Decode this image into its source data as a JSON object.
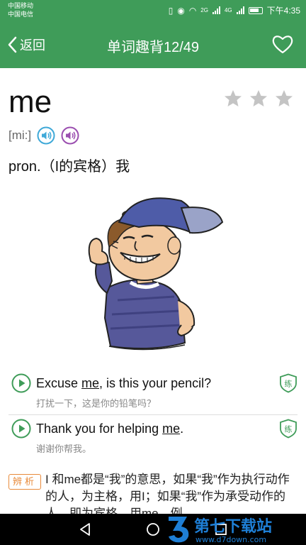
{
  "status_bar": {
    "carrier_1": "中国移动",
    "carrier_2": "中国电信",
    "signal_labels": [
      "2G",
      "4G"
    ],
    "time": "下午4:35"
  },
  "header": {
    "back_label": "返回",
    "title": "单词趣背12/49",
    "favorite_icon": "heart-outline-icon"
  },
  "word": {
    "text": "me",
    "rating": 0,
    "rating_max": 3,
    "phonetic": "[mi:]",
    "definition": "pron.（I的宾格）我"
  },
  "examples": [
    {
      "en_before": "Excuse ",
      "en_highlight": "me",
      "en_after": ", is this your pencil?",
      "cn": "打扰一下，这是你的铅笔吗？",
      "practice_label": "练"
    },
    {
      "en_before": "Thank you for helping ",
      "en_highlight": "me",
      "en_after": ".",
      "cn": "谢谢你帮我。",
      "practice_label": "练"
    }
  ],
  "analysis": {
    "badge": "辨析",
    "text": "I 和me都是“我”的意思，如果“我”作为执行动作的人，为主格，用I；如果“我”作为承受动作的人，即为宾格，用me。例"
  },
  "watermark": {
    "title": "第七下载站",
    "url": "www.d7down.com"
  },
  "colors": {
    "primary_green": "#3f9c59",
    "audio_blue": "#3fa9d8",
    "audio_purple": "#9b4fb0",
    "star_gray": "#c4c4c4",
    "analysis_orange": "#e88a3a",
    "watermark_blue": "#1e7fd6"
  }
}
